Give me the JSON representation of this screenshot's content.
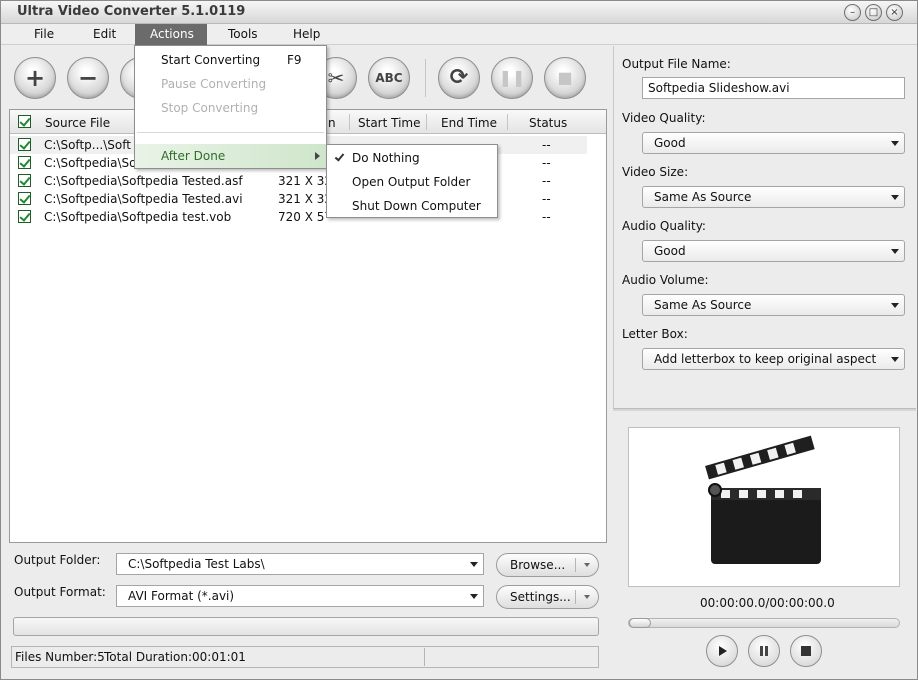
{
  "window": {
    "title": "Ultra Video Converter 5.1.0119"
  },
  "menubar": {
    "file": "File",
    "edit": "Edit",
    "actions": "Actions",
    "tools": "Tools",
    "help": "Help"
  },
  "toolbar": {
    "add_icon": "plus-icon",
    "remove_icon": "minus-icon",
    "cut_icon": "scissors-icon",
    "rename_label": "ABC",
    "convert_icon": "convert-icon",
    "pause_icon": "pause-icon",
    "stop_icon": "stop-icon"
  },
  "file_list": {
    "columns": {
      "source": "Source File",
      "duration": "n",
      "start": "Start Time",
      "end": "End Time",
      "status": "Status"
    },
    "rows": [
      {
        "source": "C:\\Softp...\\Soft",
        "size": "",
        "start": "",
        "end": "",
        "status": "--"
      },
      {
        "source": "C:\\Softpedia\\Sof",
        "size": "",
        "start": "",
        "end": "",
        "status": "--"
      },
      {
        "source": "C:\\Softpedia\\Softpedia Tested.asf",
        "size": "321 X 32",
        "start": "",
        "end": "",
        "status": "--"
      },
      {
        "source": "C:\\Softpedia\\Softpedia Tested.avi",
        "size": "321 X 32",
        "start": "",
        "end": "",
        "status": "--"
      },
      {
        "source": "C:\\Softpedia\\Softpedia test.vob",
        "size": "720 X 57",
        "start": "",
        "end": "",
        "status": "--"
      }
    ]
  },
  "actions_menu": {
    "start": "Start Converting",
    "start_shortcut": "F9",
    "pause": "Pause Converting",
    "stop": "Stop Converting",
    "after_done": "After Done"
  },
  "after_done_menu": {
    "do_nothing": "Do Nothing",
    "open_folder": "Open Output Folder",
    "shutdown": "Shut Down Computer"
  },
  "output": {
    "folder_label": "Output Folder:",
    "folder_value": "C:\\Softpedia Test Labs\\",
    "browse": "Browse...",
    "format_label": "Output Format:",
    "format_value": "AVI Format (*.avi)",
    "settings": "Settings..."
  },
  "status_bar": {
    "files": "Files Number:5",
    "duration": "Total Duration:00:01:01"
  },
  "settings_panel": {
    "file_name_label": "Output File Name:",
    "file_name_value": "Softpedia Slideshow.avi",
    "video_quality_label": "Video Quality:",
    "video_quality_value": "Good",
    "video_size_label": "Video Size:",
    "video_size_value": "Same As Source",
    "audio_quality_label": "Audio Quality:",
    "audio_quality_value": "Good",
    "audio_volume_label": "Audio Volume:",
    "audio_volume_value": "Same As Source",
    "letterbox_label": "Letter Box:",
    "letterbox_value": "Add letterbox to keep original aspect"
  },
  "player": {
    "time": "00:00:00.0/00:00:00.0",
    "position": 0.0
  }
}
